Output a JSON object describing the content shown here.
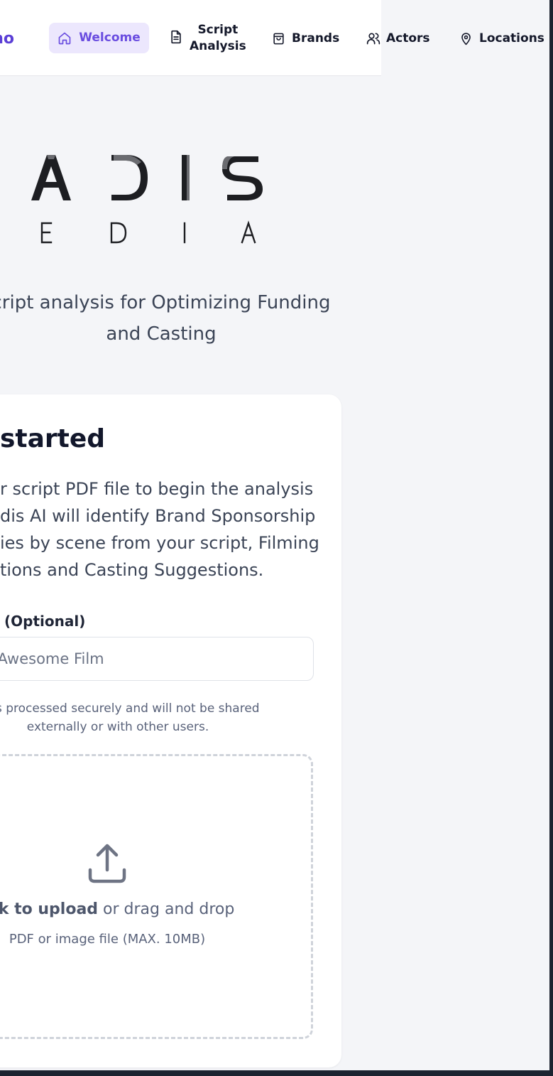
{
  "nav": {
    "brand": "mo",
    "items": [
      {
        "label": "Welcome",
        "icon": "home-icon",
        "active": true
      },
      {
        "label_line1": "Script",
        "label_line2": "Analysis",
        "icon": "document-icon"
      },
      {
        "label": "Brands",
        "icon": "shopping-bag-icon"
      },
      {
        "label": "Actors",
        "icon": "users-icon"
      },
      {
        "label": "Locations",
        "icon": "map-pin-icon"
      }
    ]
  },
  "logo": {
    "top": [
      "A",
      "D",
      "I",
      "S"
    ],
    "bottom": [
      "E",
      "D",
      "I",
      "A"
    ]
  },
  "tagline": {
    "line1": "cript analysis for Optimizing Funding",
    "line2": "and Casting"
  },
  "card": {
    "title": "started",
    "description": [
      "r script PDF file to begin the analysis",
      "dis AI will identify Brand Sponsorship",
      "ies by scene from your script, Filming",
      "tions and Casting Suggestions."
    ],
    "field_label": "(Optional)",
    "input_placeholder": "s, My Awesome Film",
    "input_value": "",
    "privacy_line1": "pt is processed securely and will not be shared",
    "privacy_line2": "externally or with other users.",
    "upload_strong": "lick to upload",
    "upload_rest": " or drag and drop",
    "upload_hint": "PDF or image file (MAX. 10MB)"
  },
  "colors": {
    "accent": "#6a4de0",
    "accent_bg": "#ece7fd",
    "page_bg": "#f4f5f8",
    "frame": "#1c2330"
  }
}
